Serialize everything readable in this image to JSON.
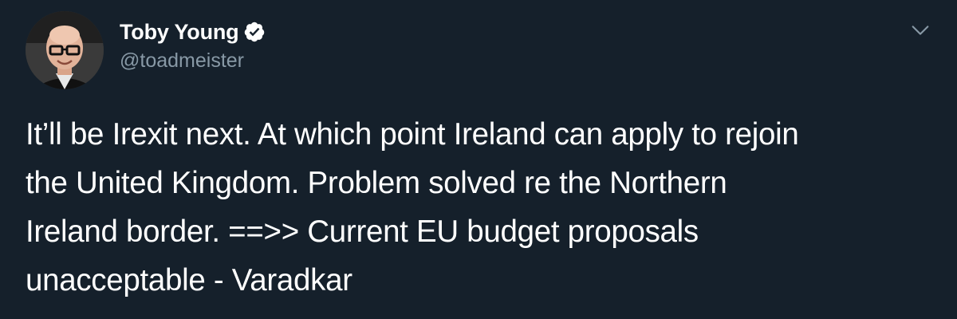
{
  "author": {
    "display_name": "Toby Young",
    "handle": "@toadmeister",
    "verified": true,
    "verified_icon": "verified-badge-icon"
  },
  "menu": {
    "icon": "chevron-down-icon"
  },
  "tweet": {
    "text": "It’ll be Irexit next. At which point Ireland can apply to rejoin\nthe United Kingdom. Problem solved re the Northern\nIreland border. ==>> Current EU budget proposals\nunacceptable - Varadkar"
  },
  "colors": {
    "background": "#15202b",
    "primary_text": "#ffffff",
    "secondary_text": "#8899a6"
  }
}
